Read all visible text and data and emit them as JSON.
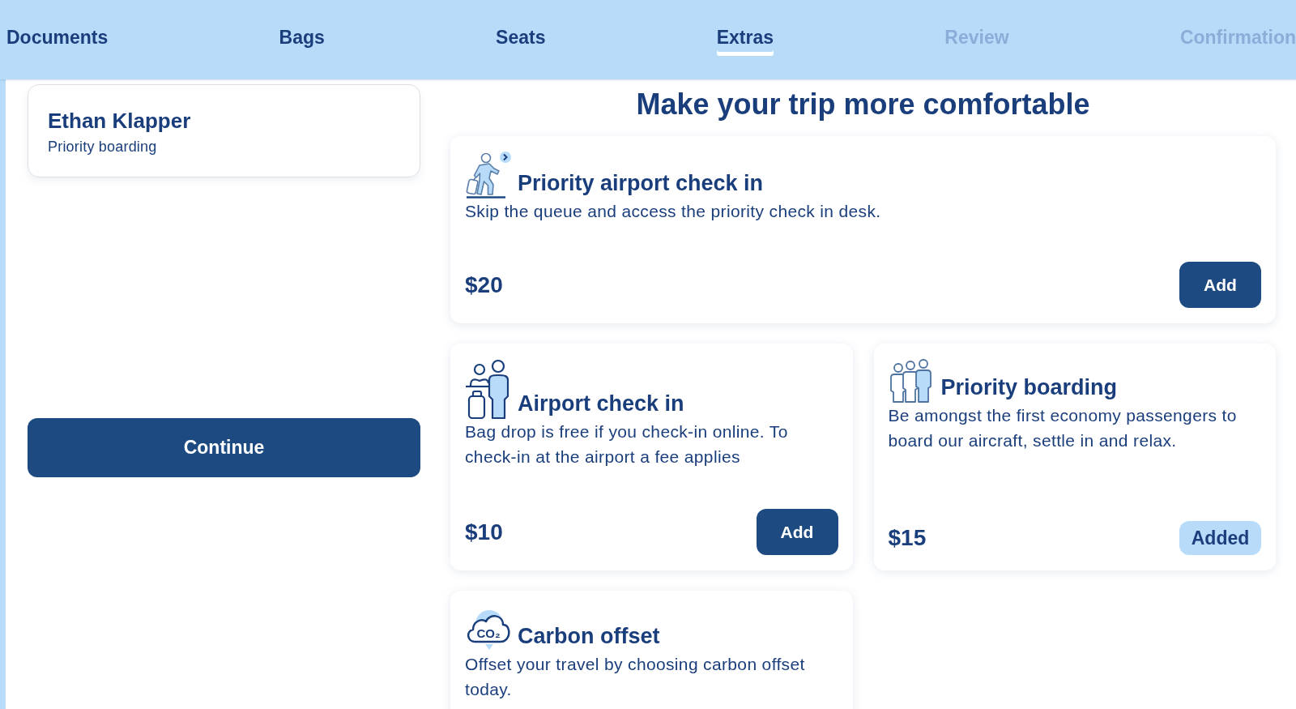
{
  "steps": [
    {
      "label": "Documents",
      "selected": false,
      "disabled": false
    },
    {
      "label": "Bags",
      "selected": false,
      "disabled": false
    },
    {
      "label": "Seats",
      "selected": false,
      "disabled": false
    },
    {
      "label": "Extras",
      "selected": true,
      "disabled": false
    },
    {
      "label": "Review",
      "selected": false,
      "disabled": true
    },
    {
      "label": "Confirmation",
      "selected": false,
      "disabled": true
    }
  ],
  "passenger": {
    "name": "Ethan Klapper",
    "extras": "Priority boarding"
  },
  "continue_button": "Continue",
  "heading": "Make your trip more comfortable",
  "extras": [
    {
      "kind": "priority-check-in",
      "title": "Priority airport check in",
      "description": "Skip the queue and access the priority check in desk.",
      "price": "$20",
      "button": "Add",
      "added": false
    },
    {
      "kind": "check-in",
      "title": "Airport check in",
      "description": "Bag drop is free if you check-in online. To check-in at the airport a fee applies",
      "price": "$10",
      "button": "Add",
      "added": false
    },
    {
      "kind": "priority-boarding",
      "title": "Priority boarding",
      "description": "Be amongst the first economy passengers to board our aircraft, settle in and relax.",
      "price": "$15",
      "button": "Added",
      "added": true
    },
    {
      "kind": "carbon-offset",
      "icon_text": "CO₂",
      "title": "Carbon offset",
      "description": "Offset your travel by choosing carbon offset today."
    }
  ]
}
